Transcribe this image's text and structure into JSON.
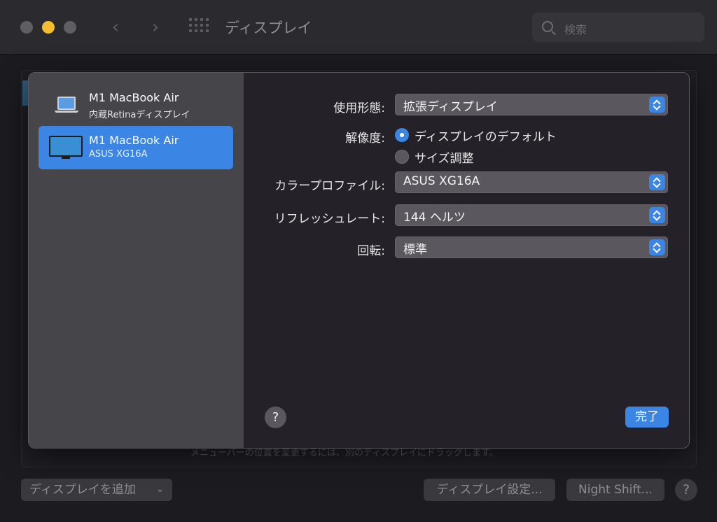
{
  "window": {
    "title": "ディスプレイ"
  },
  "search": {
    "placeholder": "検索"
  },
  "background": {
    "note": "メニューバーの位置を変更するには、別のディスプレイにドラッグします。",
    "add_display_label": "ディスプレイを追加",
    "display_settings_label": "ディスプレイ設定...",
    "night_shift_label": "Night Shift...",
    "help_label": "?"
  },
  "displays": [
    {
      "name": "M1 MacBook Air",
      "subtitle": "内蔵Retinaディスプレイ",
      "icon": "laptop-icon",
      "selected": false
    },
    {
      "name": "M1 MacBook Air",
      "subtitle": "ASUS XG16A",
      "icon": "monitor-icon",
      "selected": true
    }
  ],
  "settings": {
    "usage": {
      "label": "使用形態:",
      "value": "拡張ディスプレイ"
    },
    "resolution": {
      "label": "解像度:",
      "options": [
        {
          "label": "ディスプレイのデフォルト",
          "selected": true
        },
        {
          "label": "サイズ調整",
          "selected": false
        }
      ]
    },
    "color_profile": {
      "label": "カラープロファイル:",
      "value": "ASUS XG16A"
    },
    "refresh_rate": {
      "label": "リフレッシュレート:",
      "value": "144 ヘルツ"
    },
    "rotation": {
      "label": "回転:",
      "value": "標準"
    }
  },
  "sheet": {
    "help_label": "?",
    "done_label": "完了"
  },
  "colors": {
    "accent": "#3b86e4",
    "yellow_light": "#f4bc2e"
  }
}
